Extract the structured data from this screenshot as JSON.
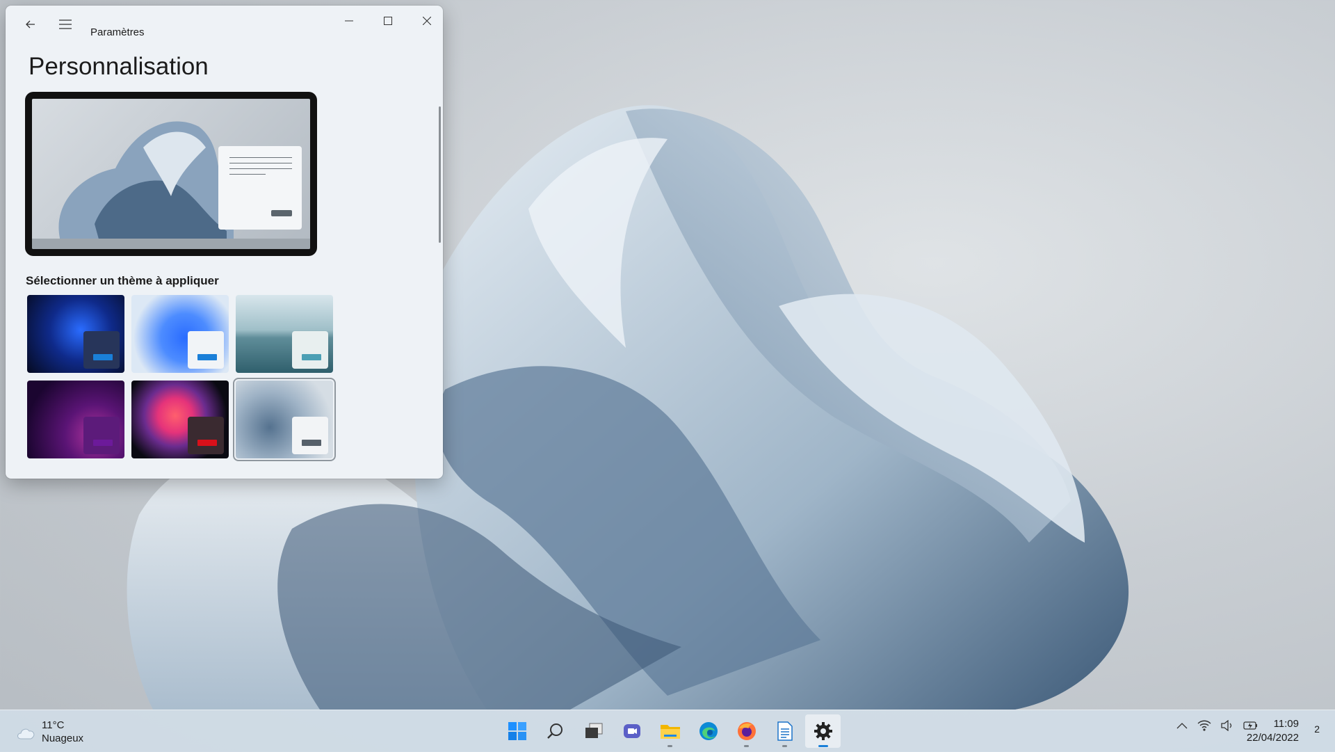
{
  "window": {
    "title": "Paramètres",
    "page_title": "Personnalisation",
    "section_label": "Sélectionner un thème à appliquer"
  },
  "themes": [
    {
      "name": "windows-dark",
      "bg": "#0b1a4a",
      "mini_bg": "#27355a",
      "bar": "#1a7fd8"
    },
    {
      "name": "windows-light",
      "bg": "#cfe0f0",
      "mini_bg": "#f1f4f7",
      "bar": "#1a7fd8"
    },
    {
      "name": "glow-lake",
      "bg": "#7fa9b5",
      "mini_bg": "#e8efef",
      "bar": "#4b9fb4"
    },
    {
      "name": "glow-purple",
      "bg": "#3a0c4f",
      "mini_bg": "#5c1b7a",
      "bar": "#6c1a9a"
    },
    {
      "name": "captured-motion",
      "bg": "#111018",
      "mini_bg": "#3a2a30",
      "bar": "#d8101a"
    },
    {
      "name": "flow-selected",
      "bg": "#aebccb",
      "mini_bg": "#f2f4f6",
      "bar": "#56606a",
      "selected": true
    }
  ],
  "taskbar": {
    "weather_temp": "11°C",
    "weather_desc": "Nuageux",
    "time": "11:09",
    "date": "22/04/2022",
    "notification_count": "2",
    "apps": [
      "start-icon",
      "search-icon",
      "task-view-icon",
      "chat-icon",
      "file-explorer-icon",
      "edge-icon",
      "firefox-icon",
      "writer-icon",
      "settings-icon"
    ]
  },
  "colors": {
    "accent": "#1a7fd8",
    "window_bg": "#eef2f6"
  }
}
